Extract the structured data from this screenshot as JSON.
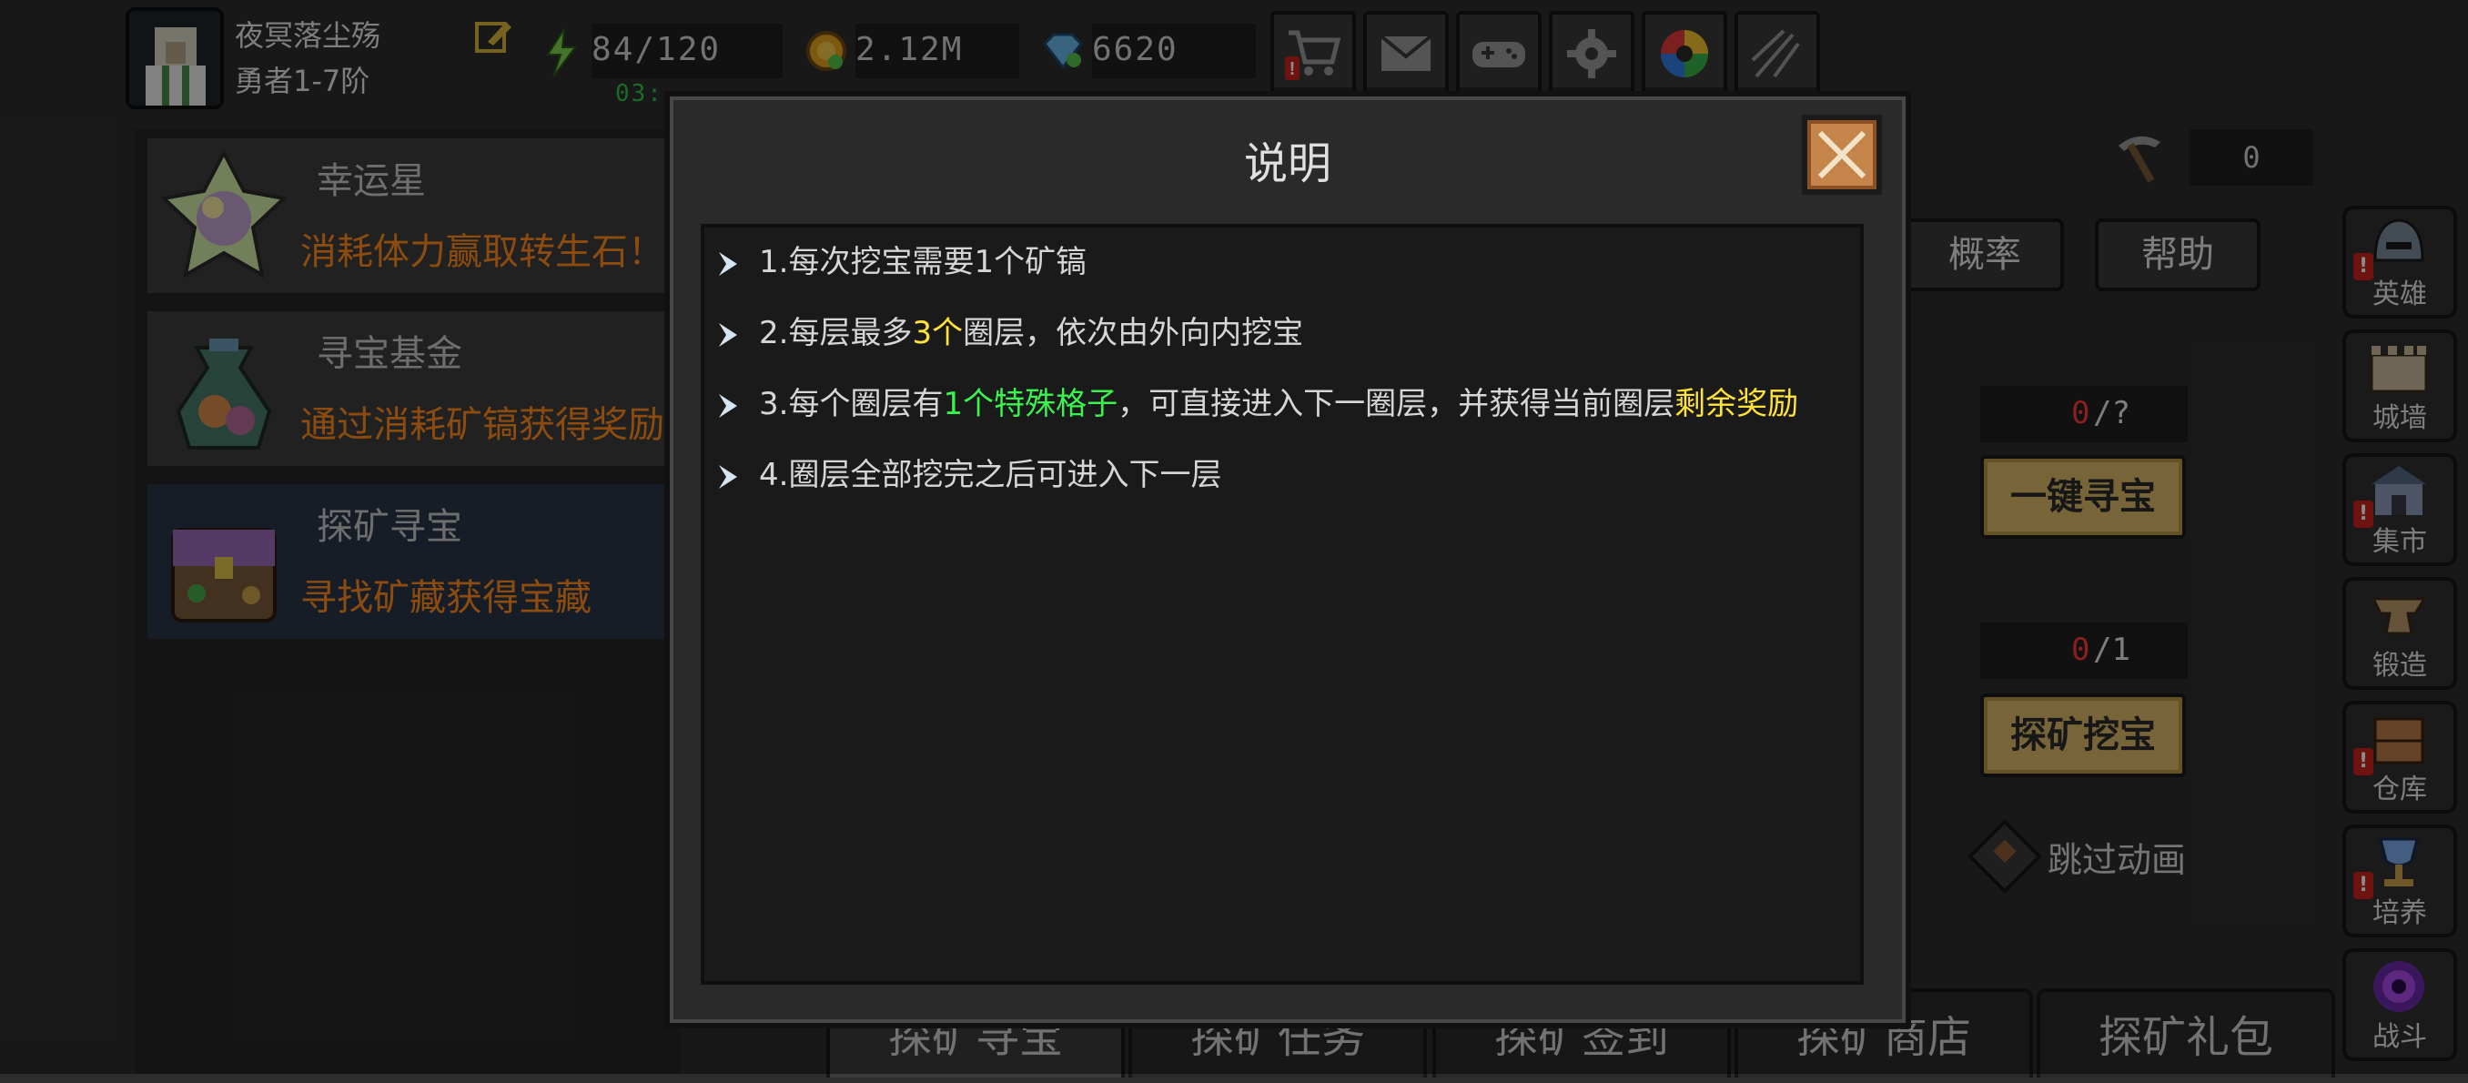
{
  "player": {
    "name": "夜冥落尘殇",
    "rank": "勇者1-7阶"
  },
  "resources": {
    "stamina": "84/120",
    "gold": "2.12M",
    "gems": "6620",
    "timer": "03:"
  },
  "top_buttons": [
    "cart-icon",
    "mail-icon",
    "gamepad-icon",
    "gear-icon",
    "color-wheel-icon",
    "firework-icon"
  ],
  "events": [
    {
      "title": "幸运星",
      "desc": "消耗体力赢取转生石！"
    },
    {
      "title": "寻宝基金",
      "desc": "通过消耗矿镐获得奖励"
    },
    {
      "title": "探矿寻宝",
      "desc": "寻找矿藏获得宝藏"
    }
  ],
  "mining": {
    "pickaxe_count": "0",
    "prob_label": "概率",
    "help_label": "帮助",
    "counter1_current": "0",
    "counter1_max": "/?",
    "btn1_label": "一键寻宝",
    "counter2_current": "0",
    "counter2_max": "/1",
    "btn2_label": "探矿挖宝",
    "skip_label": "跳过动画"
  },
  "side_menu": [
    {
      "label": "英雄",
      "alert": true
    },
    {
      "label": "城墙",
      "alert": false
    },
    {
      "label": "集市",
      "alert": true
    },
    {
      "label": "锻造",
      "alert": false
    },
    {
      "label": "仓库",
      "alert": true
    },
    {
      "label": "培养",
      "alert": true
    },
    {
      "label": "战斗",
      "alert": false
    }
  ],
  "tabs": [
    "探矿寻宝",
    "探矿任务",
    "探矿签到",
    "探矿商店",
    "探矿礼包"
  ],
  "modal": {
    "title": "说明",
    "rules": [
      {
        "prefix": "1.每次挖宝需要1个矿镐",
        "hl": "",
        "mid": "",
        "hl2": ""
      },
      {
        "prefix": "2.每层最多",
        "hl": "3个",
        "mid": "圈层，依次由外向内挖宝",
        "hl2": ""
      },
      {
        "prefix": "3.每个圈层有",
        "hl": "1个特殊格子",
        "mid": "，可直接进入下一圈层，并获得当前圈层",
        "hl2": "剩余奖励"
      },
      {
        "prefix": "4.圈层全部挖完之后可进入下一层",
        "hl": "",
        "mid": "",
        "hl2": ""
      }
    ]
  },
  "colors": {
    "accent_orange": "#ff8a1e",
    "highlight_yellow": "#ffe23a",
    "highlight_green": "#3bf34f",
    "counter_red": "#ff3a3a",
    "button_gold": "#d9b968"
  }
}
